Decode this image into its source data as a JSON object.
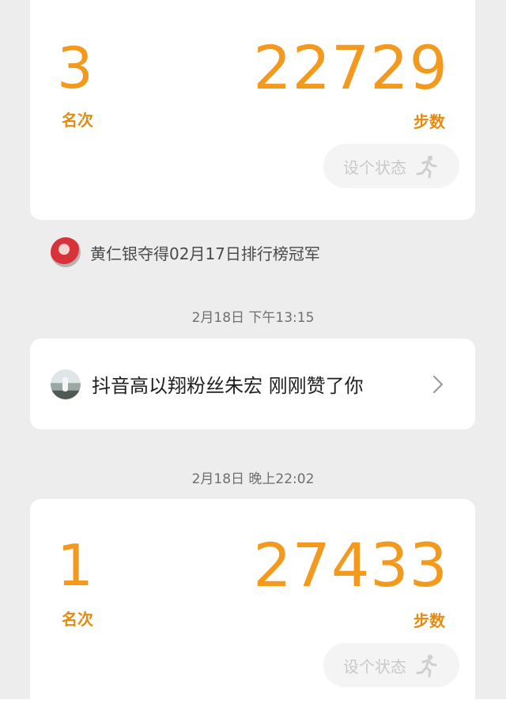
{
  "entries": [
    {
      "rank": "3",
      "rank_label": "名次",
      "steps": "22729",
      "steps_label": "步数",
      "status_button": "设个状态"
    },
    {
      "rank": "1",
      "rank_label": "名次",
      "steps": "27433",
      "steps_label": "步数",
      "status_button": "设个状态"
    }
  ],
  "champion_notice": "黄仁银夺得02月17日排行榜冠军",
  "timestamps": [
    "2月18日 下午13:15",
    "2月18日 晚上22:02"
  ],
  "like_notice": "抖音高以翔粉丝朱宏 刚刚赞了你",
  "colors": {
    "accent": "#f39a1e",
    "background": "#ededed",
    "card": "#ffffff"
  },
  "icons": [
    "running-person-icon",
    "chevron-right-icon"
  ]
}
